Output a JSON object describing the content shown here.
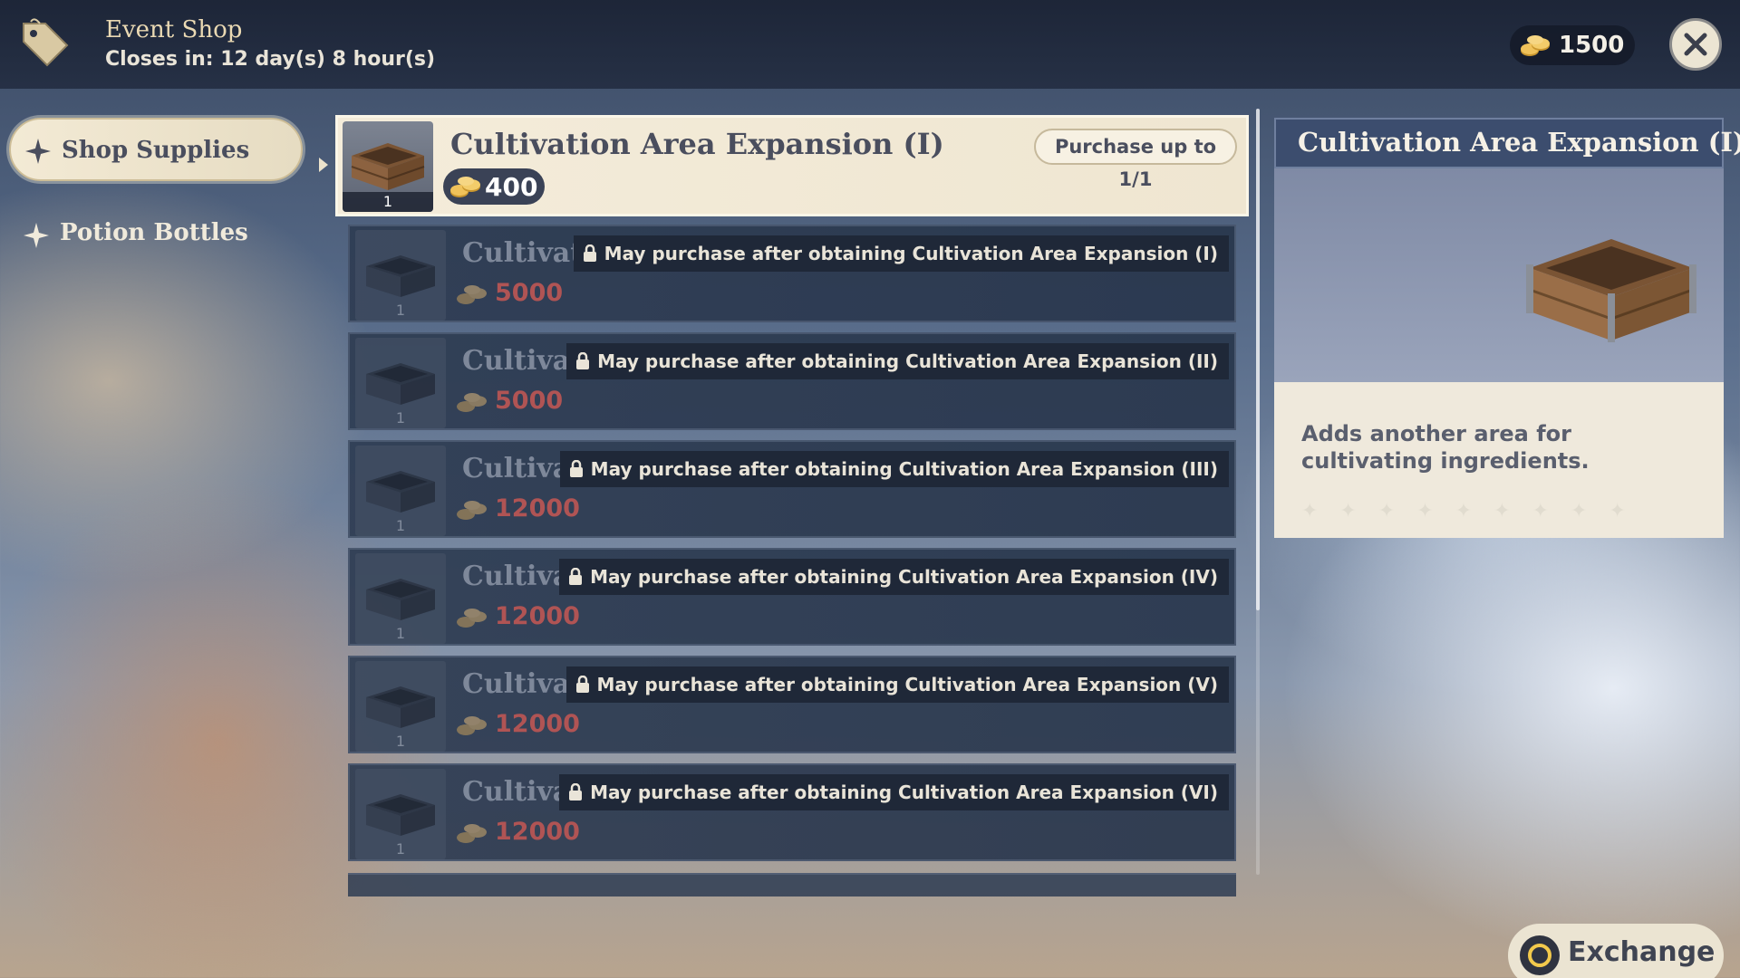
{
  "header": {
    "title": "Event Shop",
    "closes": "Closes in: 12 day(s) 8 hour(s)",
    "currency_amount": "1500",
    "close_icon": "close-icon"
  },
  "categories": [
    {
      "label": "Shop Supplies",
      "active": true,
      "icon": "star-icon"
    },
    {
      "label": "Potion Bottles",
      "active": false,
      "icon": "star-icon"
    }
  ],
  "selected_item": {
    "name": "Cultivation Area Expansion (I)",
    "quantity": "1",
    "price": "400",
    "limit": "Purchase up to 1/1"
  },
  "locked_items": [
    {
      "name": "Cultivation Area Expansion (II)",
      "quantity": "1",
      "price": "5000",
      "lock_note": "May purchase after obtaining Cultivation Area Expansion (I)"
    },
    {
      "name": "Cultivation Area Expansion (III)",
      "quantity": "1",
      "price": "5000",
      "lock_note": "May purchase after obtaining Cultivation Area Expansion (II)"
    },
    {
      "name": "Cultivation Area Expansion (IV)",
      "quantity": "1",
      "price": "12000",
      "lock_note": "May purchase after obtaining Cultivation Area Expansion (III)"
    },
    {
      "name": "Cultivation Area Expansion (V)",
      "quantity": "1",
      "price": "12000",
      "lock_note": "May purchase after obtaining Cultivation Area Expansion (IV)"
    },
    {
      "name": "Cultivation Area Expansion (VI)",
      "quantity": "1",
      "price": "12000",
      "lock_note": "May purchase after obtaining Cultivation Area Expansion (V)"
    },
    {
      "name": "Cultivation Area Expansion (VII)",
      "quantity": "1",
      "price": "12000",
      "lock_note": "May purchase after obtaining Cultivation Area Expansion (VI)"
    }
  ],
  "detail": {
    "title": "Cultivation Area Expansion (I)",
    "description": "Adds another area for cultivating ingredients."
  },
  "exchange": {
    "label": "Exchange"
  },
  "colors": {
    "locked_price": "#b05454",
    "header_bg": "#1c2436",
    "panel_cream": "#efe9dc"
  }
}
